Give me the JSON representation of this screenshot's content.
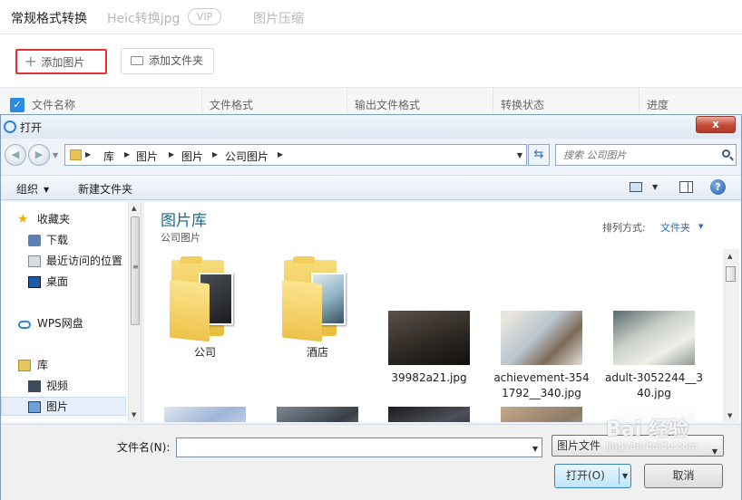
{
  "app": {
    "tabs": [
      {
        "label": "常规格式转换"
      },
      {
        "label": "Heic转换jpg"
      },
      {
        "label": "图片压缩"
      }
    ],
    "vip_badge": "VIP",
    "toolbar": {
      "add_image": "添加图片",
      "add_folder": "添加文件夹"
    },
    "columns": [
      "文件名称",
      "文件格式",
      "输出文件格式",
      "转换状态",
      "进度"
    ]
  },
  "dialog": {
    "title": "打开",
    "close": "x",
    "breadcrumb": [
      "库",
      "图片",
      "图片",
      "公司图片"
    ],
    "search_placeholder": "搜索 公司图片",
    "commands": {
      "organize": "组织",
      "new_folder": "新建文件夹",
      "help": "?"
    },
    "nav": {
      "items": [
        {
          "label": "收藏夹",
          "icon": "star-icon"
        },
        {
          "label": "下载",
          "icon": "download-folder-icon"
        },
        {
          "label": "最近访问的位置",
          "icon": "recent-places-icon"
        },
        {
          "label": "桌面",
          "icon": "desktop-icon"
        },
        {
          "label": "WPS网盘",
          "icon": "cloud-icon"
        },
        {
          "label": "库",
          "icon": "library-icon"
        },
        {
          "label": "视频",
          "icon": "video-icon"
        },
        {
          "label": "图片",
          "icon": "picture-icon",
          "selected": true
        }
      ]
    },
    "content": {
      "title": "图片库",
      "subtitle": "公司图片",
      "arrange_label": "排列方式:",
      "arrange_value": "文件夹",
      "items": [
        {
          "label": "公司",
          "kind": "folder"
        },
        {
          "label": "酒店",
          "kind": "folder"
        },
        {
          "label": "39982a21.jpg",
          "kind": "image"
        },
        {
          "label": "achievement-3541792__340.jpg",
          "kind": "image"
        },
        {
          "label": "adult-3052244__340.jpg",
          "kind": "image"
        },
        {
          "label": "",
          "kind": "image"
        },
        {
          "label": "",
          "kind": "image"
        },
        {
          "label": "",
          "kind": "image"
        },
        {
          "label": "",
          "kind": "image"
        },
        {
          "label": "",
          "kind": "image"
        }
      ]
    },
    "filename_label": "文件名(N):",
    "filename_value": "",
    "filetype": "图片文件",
    "open_button": "打开(O)",
    "cancel_button": "取消"
  },
  "watermark": {
    "main": "Bai 经验",
    "sub": "jingyan.baidu.com"
  }
}
